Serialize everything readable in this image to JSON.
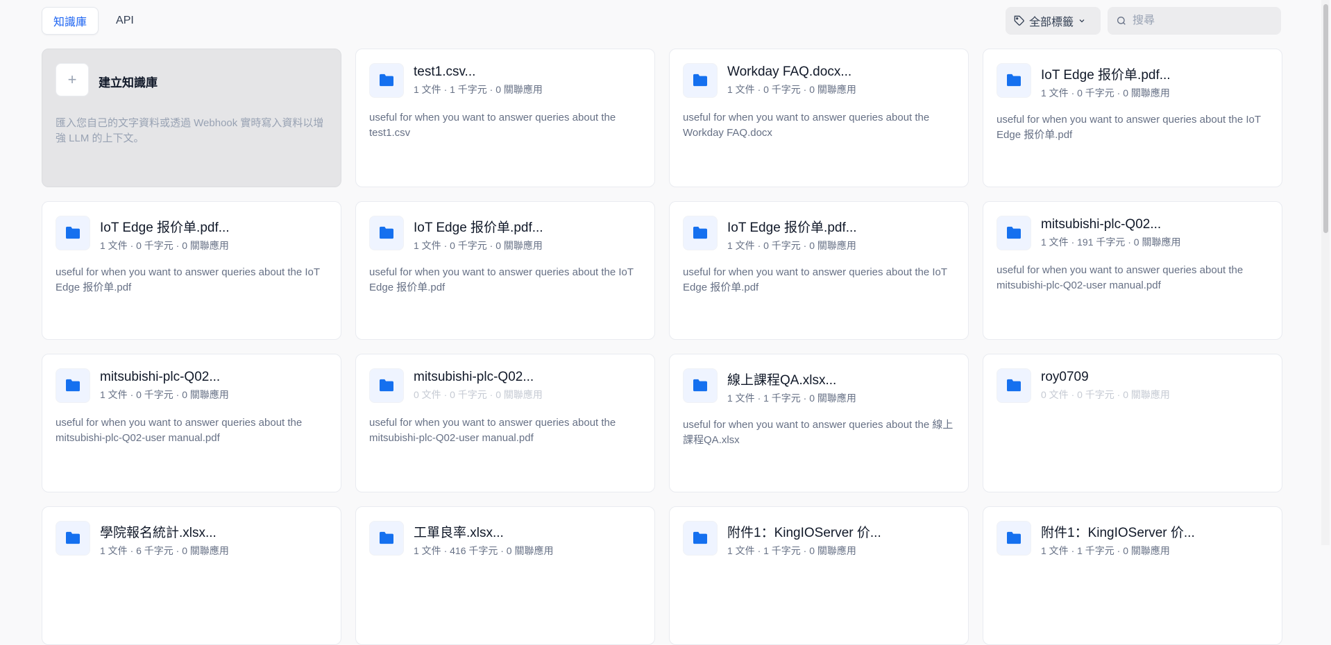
{
  "tabs": [
    {
      "label": "知識庫",
      "active": true
    },
    {
      "label": "API",
      "active": false
    }
  ],
  "tag_filter": {
    "label": "全部標籤",
    "icon": "tag-icon"
  },
  "search": {
    "placeholder": "搜尋",
    "value": ""
  },
  "create_card": {
    "title": "建立知識庫",
    "description": "匯入您自己的文字資料或透過 Webhook 實時寫入資料以增強 LLM 的上下文。"
  },
  "datasets": [
    {
      "title": "test1.csv...",
      "meta": "1 文件 · 1 千字元 · 0 關聯應用",
      "description": "useful for when you want to answer queries about the test1.csv"
    },
    {
      "title": "Workday FAQ.docx...",
      "meta": "1 文件 · 0 千字元 · 0 關聯應用",
      "description": "useful for when you want to answer queries about the Workday FAQ.docx"
    },
    {
      "title": "IoT Edge 报价单.pdf...",
      "meta": "1 文件 · 0 千字元 · 0 關聯應用",
      "description": "useful for when you want to answer queries about the IoT Edge 报价单.pdf"
    },
    {
      "title": "IoT Edge 报价单.pdf...",
      "meta": "1 文件 · 0 千字元 · 0 關聯應用",
      "description": "useful for when you want to answer queries about the IoT Edge 报价单.pdf"
    },
    {
      "title": "IoT Edge 报价单.pdf...",
      "meta": "1 文件 · 0 千字元 · 0 關聯應用",
      "description": "useful for when you want to answer queries about the IoT Edge 报价单.pdf"
    },
    {
      "title": "IoT Edge 报价单.pdf...",
      "meta": "1 文件 · 0 千字元 · 0 關聯應用",
      "description": "useful for when you want to answer queries about the IoT Edge 报价单.pdf"
    },
    {
      "title": "mitsubishi-plc-Q02...",
      "meta": "1 文件 · 191 千字元 · 0 關聯應用",
      "description": "useful for when you want to answer queries about the mitsubishi-plc-Q02-user manual.pdf"
    },
    {
      "title": "mitsubishi-plc-Q02...",
      "meta": "1 文件 · 0 千字元 · 0 關聯應用",
      "description": "useful for when you want to answer queries about the mitsubishi-plc-Q02-user manual.pdf"
    },
    {
      "title": "mitsubishi-plc-Q02...",
      "meta": "0 文件 · 0 千字元 · 0 關聯應用",
      "meta_dim": true,
      "description": "useful for when you want to answer queries about the mitsubishi-plc-Q02-user manual.pdf"
    },
    {
      "title": "線上課程QA.xlsx...",
      "meta": "1 文件 · 1 千字元 · 0 關聯應用",
      "description": "useful for when you want to answer queries about the 線上課程QA.xlsx"
    },
    {
      "title": "roy0709",
      "meta": "0 文件 · 0 千字元 · 0 關聯應用",
      "meta_dim": true,
      "description": ""
    },
    {
      "title": "學院報名統計.xlsx...",
      "meta": "1 文件 · 6 千字元 · 0 關聯應用",
      "description": ""
    },
    {
      "title": "工單良率.xlsx...",
      "meta": "1 文件 · 416 千字元 · 0 關聯應用",
      "description": ""
    },
    {
      "title": "附件1：KingIOServer 价...",
      "meta": "1 文件 · 1 千字元 · 0 關聯應用",
      "description": ""
    },
    {
      "title": "附件1：KingIOServer 价...",
      "meta": "1 文件 · 1 千字元 · 0 關聯應用",
      "description": ""
    }
  ],
  "colors": {
    "accent": "#1c64f2",
    "folder": "#1570ef"
  }
}
